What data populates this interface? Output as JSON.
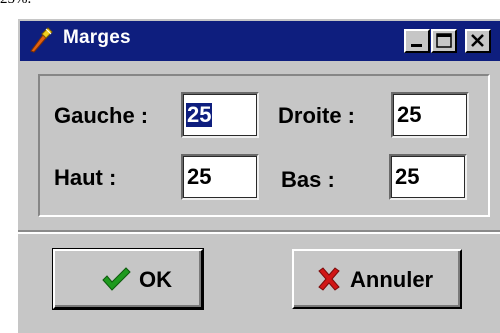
{
  "top_text": "25%.",
  "window": {
    "title": "Marges",
    "icon": "paintbrush-icon",
    "controls": [
      "minimize-icon",
      "maximize-icon",
      "close-icon"
    ]
  },
  "fields": {
    "gauche": {
      "label": "Gauche :",
      "value": "25",
      "selected": true
    },
    "droite": {
      "label": "Droite :",
      "value": "25"
    },
    "haut": {
      "label": "Haut :",
      "value": "25"
    },
    "bas": {
      "label": "Bas :",
      "value": "25"
    }
  },
  "buttons": {
    "ok": {
      "label": "OK",
      "icon": "checkmark-icon",
      "icon_color": "#1e9a1e"
    },
    "cancel": {
      "label": "Annuler",
      "icon": "x-icon",
      "icon_color": "#d11616"
    }
  },
  "colors": {
    "titlebar": "#0e1e7e",
    "face": "#c6c6c6",
    "selection": "#0e1e7e"
  }
}
